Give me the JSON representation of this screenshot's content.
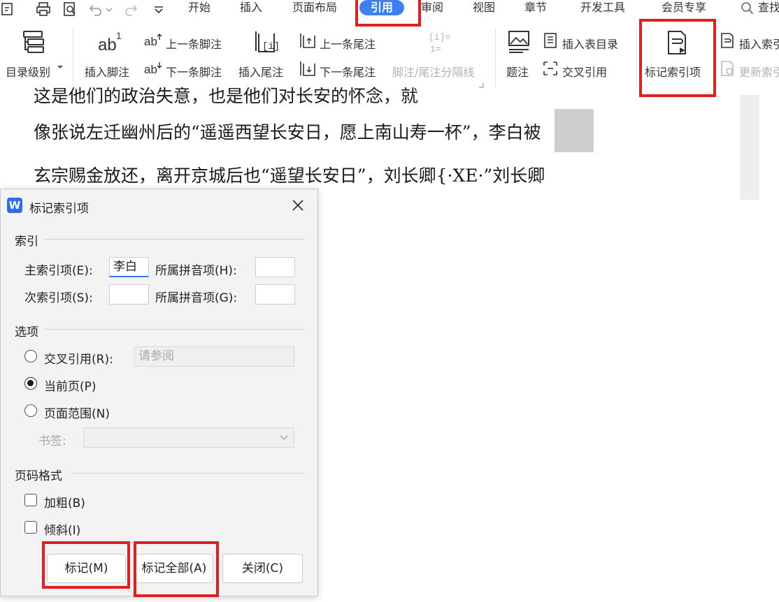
{
  "menu": {
    "tabs": [
      "开始",
      "插入",
      "页面布局",
      "引用",
      "审阅",
      "视图",
      "章节",
      "开发工具",
      "会员专享"
    ],
    "active_tab": "引用",
    "search": "查找"
  },
  "ribbon": {
    "toc_level": "目录级别",
    "insert_footnote": "插入脚注",
    "prev_footnote": "上一条脚注",
    "next_footnote": "下一条脚注",
    "insert_endnote": "插入尾注",
    "prev_endnote": "上一条尾注",
    "next_endnote": "下一条尾注",
    "separator": "脚注/尾注分隔线",
    "caption": "题注",
    "insert_table_of_figures": "插入表目录",
    "cross_reference": "交叉引用",
    "mark_index_entry": "标记索引项",
    "insert_index": "插入索引",
    "update_index": "更新索引"
  },
  "document": {
    "line0": "这是他们的政治失意，也是他们对长安的怀念，就",
    "line1": "像张说左迁幽州后的“遥遥西望长安日，愿上南山寿一杯”，李白被",
    "line2": "玄宗赐金放还，离开京城后也“遥望长安日”，刘长卿{·XE·”刘长卿",
    "highlight": "李白"
  },
  "dialog": {
    "title": "标记索引项",
    "index_section": "索引",
    "main_entry_label": "主索引项(E):",
    "main_entry_value": "李白",
    "main_pinyin_label": "所属拼音项(H):",
    "main_pinyin_value": "",
    "sub_entry_label": "次索引项(S):",
    "sub_entry_value": "",
    "sub_pinyin_label": "所属拼音项(G):",
    "sub_pinyin_value": "",
    "options_section": "选项",
    "cross_ref_label": "交叉引用(R):",
    "cross_ref_value": "请参阅",
    "current_page_label": "当前页(P)",
    "page_range_label": "页面范围(N)",
    "bookmark_label": "书签:",
    "format_section": "页码格式",
    "bold_label": "加粗(B)",
    "italic_label": "倾斜(I)",
    "mark_button": "标记(M)",
    "mark_all_button": "标记全部(A)",
    "close_button": "关闭(C)",
    "selected_option": "当前页(P)",
    "bold_checked": false,
    "italic_checked": false
  },
  "colors": {
    "accent": "#3f7ff2",
    "annotation": "#e02020",
    "highlight": "#cfcfcf"
  }
}
